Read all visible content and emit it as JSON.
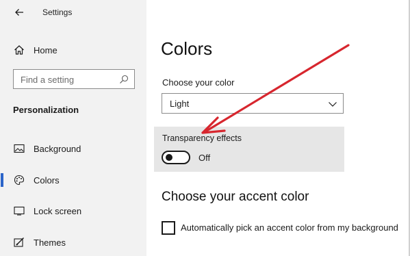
{
  "window": {
    "title": "Settings",
    "back_icon": "back-arrow-icon"
  },
  "sidebar": {
    "home": {
      "label": "Home",
      "icon": "home-icon"
    },
    "search": {
      "placeholder": "Find a setting",
      "icon": "search-icon"
    },
    "section_heading": "Personalization",
    "items": [
      {
        "label": "Background",
        "icon": "picture-icon",
        "active": false
      },
      {
        "label": "Colors",
        "icon": "palette-icon",
        "active": true
      },
      {
        "label": "Lock screen",
        "icon": "lock-screen-icon",
        "active": false
      },
      {
        "label": "Themes",
        "icon": "themes-icon",
        "active": false
      }
    ],
    "active_color": "#2b64c9"
  },
  "main": {
    "title": "Colors",
    "choose_color": {
      "label": "Choose your color",
      "selected_value": "Light"
    },
    "transparency": {
      "label": "Transparency effects",
      "state_label": "Off",
      "enabled": false
    },
    "accent": {
      "heading": "Choose your accent color",
      "auto_pick_label": "Automatically pick an accent color from my background",
      "auto_pick_checked": false
    }
  },
  "annotation": {
    "type": "arrow",
    "color": "#d7262e"
  }
}
